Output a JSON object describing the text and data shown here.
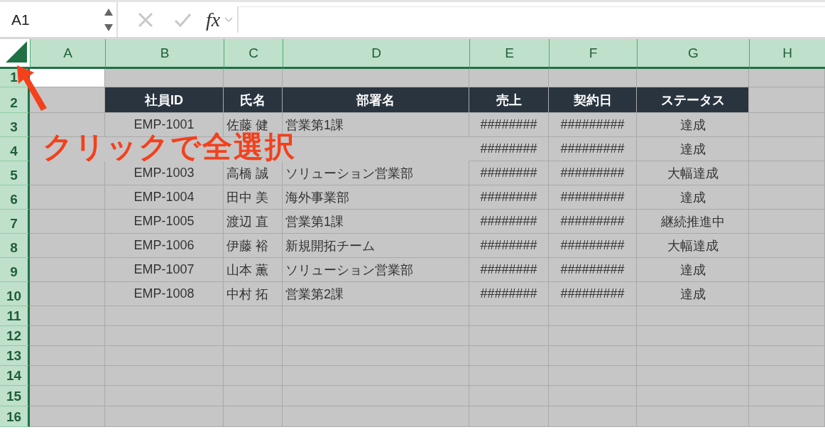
{
  "name_box": "A1",
  "formula_bar": {
    "fx": "fx"
  },
  "columns": [
    "A",
    "B",
    "C",
    "D",
    "E",
    "F",
    "G",
    "H"
  ],
  "active_cell_shown": true,
  "headings": [
    "社員ID",
    "氏名",
    "部署名",
    "売上",
    "契約日",
    "ステータス"
  ],
  "rows": [
    {
      "label": "1",
      "kind": "empty"
    },
    {
      "label": "2",
      "kind": "header"
    },
    {
      "label": "3",
      "kind": "data",
      "id": "EMP-1001",
      "name": "佐藤 健",
      "dept": "営業第1課",
      "sales": "########",
      "date": "#########",
      "status": "達成"
    },
    {
      "label": "4",
      "kind": "data",
      "sales": "########",
      "date": "#########",
      "status": "達成"
    },
    {
      "label": "5",
      "kind": "data",
      "id": "EMP-1003",
      "name": "高橋 誠",
      "dept": "ソリューション営業部",
      "sales": "########",
      "date": "#########",
      "status": "大幅達成"
    },
    {
      "label": "6",
      "kind": "data",
      "id": "EMP-1004",
      "name": "田中 美",
      "dept": "海外事業部",
      "sales": "########",
      "date": "#########",
      "status": "達成"
    },
    {
      "label": "7",
      "kind": "data",
      "id": "EMP-1005",
      "name": "渡辺 直",
      "dept": "営業第1課",
      "sales": "########",
      "date": "#########",
      "status": "継続推進中"
    },
    {
      "label": "8",
      "kind": "data",
      "id": "EMP-1006",
      "name": "伊藤 裕",
      "dept": "新規開拓チーム",
      "sales": "########",
      "date": "#########",
      "status": "大幅達成"
    },
    {
      "label": "9",
      "kind": "data",
      "id": "EMP-1007",
      "name": "山本 薫",
      "dept": "ソリューション営業部",
      "sales": "########",
      "date": "#########",
      "status": "達成"
    },
    {
      "label": "10",
      "kind": "data",
      "id": "EMP-1008",
      "name": "中村 拓",
      "dept": "営業第2課",
      "sales": "########",
      "date": "#########",
      "status": "達成"
    },
    {
      "label": "11",
      "kind": "empty"
    },
    {
      "label": "12",
      "kind": "empty"
    },
    {
      "label": "13",
      "kind": "empty"
    },
    {
      "label": "14",
      "kind": "empty"
    },
    {
      "label": "15",
      "kind": "empty"
    },
    {
      "label": "16",
      "kind": "empty"
    }
  ],
  "annotation": {
    "text": "クリックで全選択"
  }
}
